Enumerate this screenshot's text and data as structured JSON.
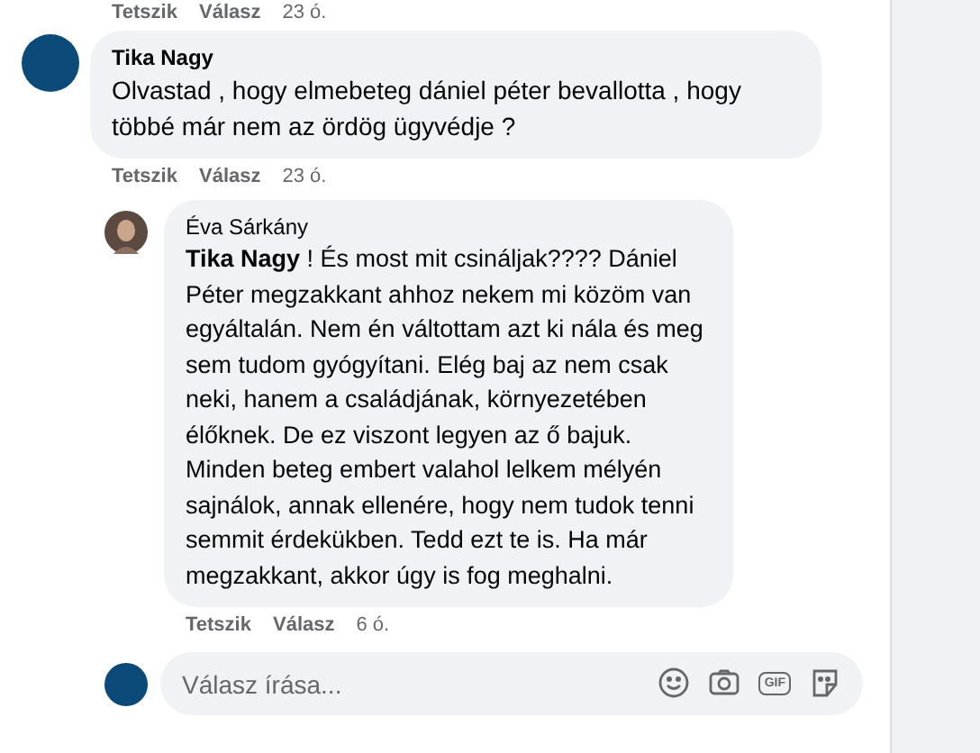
{
  "top_actions": {
    "like": "Tetszik",
    "reply": "Válasz",
    "time": "23 ó."
  },
  "comments": [
    {
      "author": "Tika Nagy",
      "kind": "plain",
      "text": "Olvastad , hogy elmebeteg dániel péter bevallotta , hogy többé már nem az ördög ügyvédje ?",
      "actions": {
        "like": "Tetszik",
        "reply": "Válasz",
        "time": "23 ó."
      },
      "replies": [
        {
          "author": "Éva Sárkány",
          "kind": "photo",
          "text": "**Tika Nagy** ! És most mit csináljak???? Dániel Péter megzakkant ahhoz nekem mi közöm van egyáltalán. Nem én váltottam azt ki nála és meg sem tudom gyógyítani. Elég baj az nem csak neki, hanem a családjának, környezetében élőknek. De ez viszont legyen az ő bajuk. Minden beteg embert valahol lelkem mélyén sajnálok, annak ellenére, hogy nem tudok tenni semmit érdekükben. Tedd ezt te is. Ha már megzakkant, akkor úgy is fog meghalni.",
          "actions": {
            "like": "Tetszik",
            "reply": "Válasz",
            "time": "6 ó."
          }
        }
      ]
    }
  ],
  "reply_box": {
    "placeholder": "Válasz írása...",
    "gif_label": "GIF"
  }
}
